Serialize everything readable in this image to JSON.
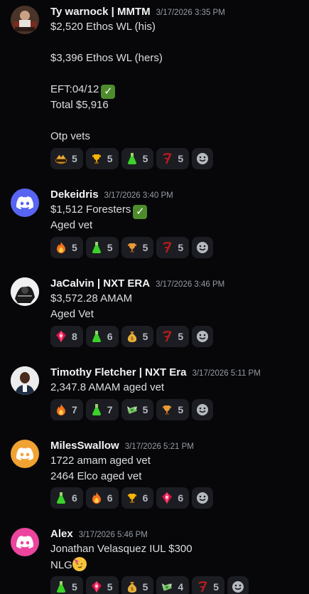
{
  "messages": [
    {
      "username": "Ty warnock | MMTM",
      "timestamp": "3/17/2026 3:35 PM",
      "lines": [
        "$2,520 Ethos WL (his)",
        "$3,396 Ethos WL (hers)",
        "EFT:04/12",
        "Total $5,916",
        "Otp vets"
      ],
      "reactions": [
        {
          "icon": "boosted-badge-emoji",
          "count": "5"
        },
        {
          "icon": "trophy-emoji",
          "count": "5"
        },
        {
          "icon": "green-potion-emoji",
          "count": "5"
        },
        {
          "icon": "red-script-emoji",
          "count": "5"
        }
      ]
    },
    {
      "username": "Dekeidris",
      "timestamp": "3/17/2026 3:40 PM",
      "lines": [
        "$1,512 Foresters",
        "Aged vet"
      ],
      "reactions": [
        {
          "icon": "fire-emoji",
          "count": "5"
        },
        {
          "icon": "green-potion-emoji",
          "count": "5"
        },
        {
          "icon": "trophy-emoji",
          "count": "5"
        },
        {
          "icon": "red-script-emoji",
          "count": "5"
        }
      ]
    },
    {
      "username": "JaCalvin | NXT ERA",
      "timestamp": "3/17/2026 3:46 PM",
      "lines": [
        "$3,572.28 AMAM",
        "Aged Vet"
      ],
      "reactions": [
        {
          "icon": "red-gem-emoji",
          "count": "8"
        },
        {
          "icon": "green-potion-emoji",
          "count": "6"
        },
        {
          "icon": "money-bag-emoji",
          "count": "5"
        },
        {
          "icon": "red-script-emoji",
          "count": "5"
        }
      ]
    },
    {
      "username": "Timothy Fletcher | NXT Era",
      "timestamp": "3/17/2026 5:11 PM",
      "lines": [
        "2,347.8 AMAM aged vet"
      ],
      "reactions": [
        {
          "icon": "fire-emoji",
          "count": "7"
        },
        {
          "icon": "green-potion-emoji",
          "count": "7"
        },
        {
          "icon": "money-wings-emoji",
          "count": "5"
        },
        {
          "icon": "trophy-emoji",
          "count": "5"
        }
      ]
    },
    {
      "username": "MilesSwallow",
      "timestamp": "3/17/2026 5:21 PM",
      "lines": [
        "1722 amam aged vet",
        "2464 Elco aged vet"
      ],
      "reactions": [
        {
          "icon": "green-potion-emoji",
          "count": "6"
        },
        {
          "icon": "fire-emoji",
          "count": "6"
        },
        {
          "icon": "trophy-emoji",
          "count": "6"
        },
        {
          "icon": "red-gem-emoji",
          "count": "6"
        }
      ]
    },
    {
      "username": "Alex",
      "timestamp": "3/17/2026 5:46 PM",
      "lines": [
        "Jonathan Velasquez IUL $300",
        "NLG"
      ],
      "reactions": [
        {
          "icon": "green-potion-emoji",
          "count": "5"
        },
        {
          "icon": "red-gem-emoji",
          "count": "5"
        },
        {
          "icon": "money-bag-emoji",
          "count": "5"
        },
        {
          "icon": "money-wings-emoji",
          "count": "4"
        },
        {
          "icon": "red-script-emoji",
          "count": "5"
        }
      ]
    }
  ],
  "colors": {
    "background": "#070709",
    "reaction_bg": "#1c1d22",
    "discord_blue": "#5865f2",
    "discord_orange": "#f0a232",
    "discord_pink": "#eb459e"
  }
}
